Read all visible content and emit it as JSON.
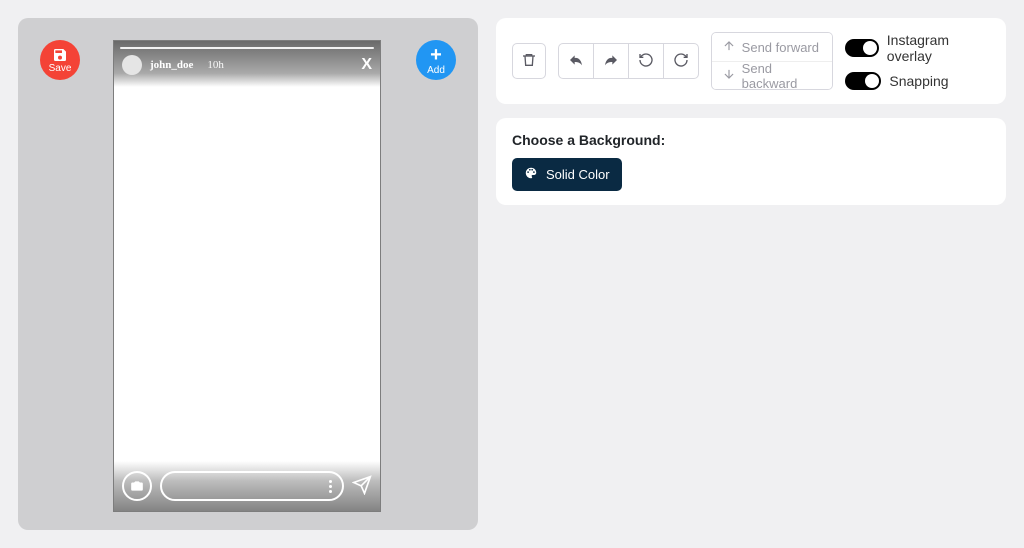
{
  "canvas": {
    "save_label": "Save",
    "add_label": "Add"
  },
  "story_overlay": {
    "username": "john_doe",
    "time": "10h",
    "close_glyph": "X"
  },
  "toolbar": {
    "send_forward": "Send forward",
    "send_backward": "Send backward"
  },
  "toggles": {
    "instagram_overlay": {
      "label": "Instagram overlay",
      "on": true
    },
    "snapping": {
      "label": "Snapping",
      "on": true
    }
  },
  "background_section": {
    "title": "Choose a Background:",
    "solid_color_label": "Solid Color"
  }
}
